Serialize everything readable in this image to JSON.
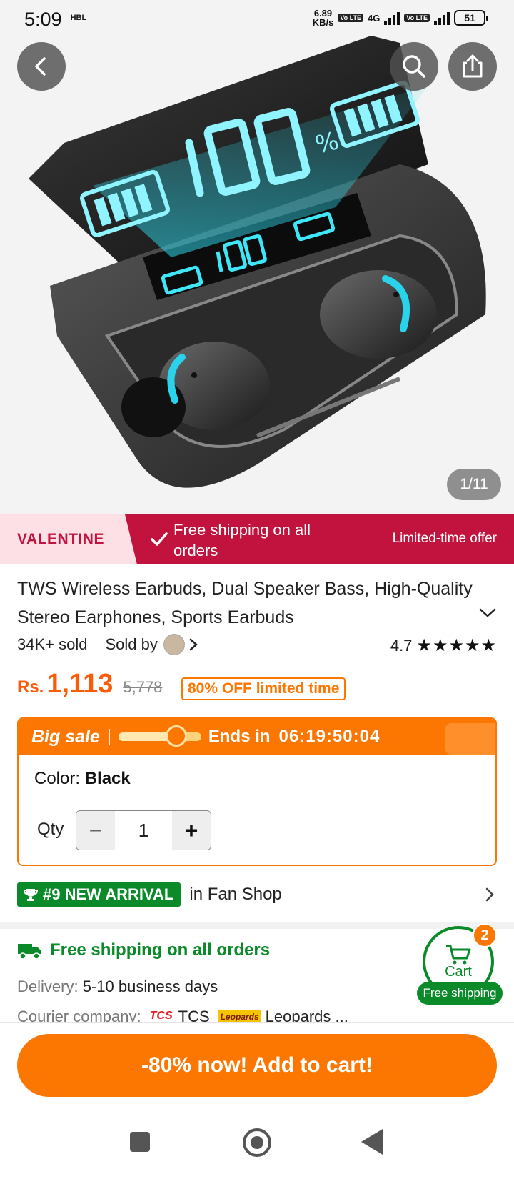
{
  "status_bar": {
    "time": "5:09",
    "carrier": "HBL",
    "speed_value": "6.89",
    "speed_unit": "KB/s",
    "volte": "Vo LTE",
    "network": "4G",
    "battery": "51"
  },
  "gallery": {
    "counter": "1/11"
  },
  "promo": {
    "badge": "VALENTINE",
    "message": "Free shipping on all orders",
    "right_text": "Limited-time offer"
  },
  "product": {
    "title": "TWS Wireless Earbuds, Dual Speaker Bass, High-Quality Stereo Earphones, Sports Earbuds",
    "sold": "34K+ sold",
    "sold_by": "Sold by",
    "rating": "4.7",
    "rating_value": 4.7,
    "stars": "★★★★★"
  },
  "price": {
    "currency": "Rs.",
    "current": "1,113",
    "original": "5,778",
    "discount_label": "80% OFF limited time"
  },
  "sale": {
    "label": "Big sale",
    "ends_label": "Ends in",
    "timer": "06:19:50:04",
    "progress": 0.7,
    "color_label": "Color:",
    "color_value": "Black",
    "qty_label": "Qty",
    "qty_minus": "−",
    "qty_value": "1",
    "qty_plus": "+"
  },
  "arrival": {
    "badge": "#9 NEW ARRIVAL",
    "text": "in Fan Shop"
  },
  "shipping": {
    "title": "Free shipping on all orders",
    "delivery_label": "Delivery:",
    "delivery_value": "5-10 business days",
    "courier_label": "Courier company:",
    "courier_tcs_logo": "TCS",
    "courier_tcs": "TCS",
    "courier_leo_logo": "Leopards",
    "courier_leo": "Leopards ..."
  },
  "cart": {
    "label": "Cart",
    "count": "2",
    "free_shipping": "Free shipping"
  },
  "actions": {
    "add_to_cart": "-80% now! Add to cart!"
  },
  "colors": {
    "accent_orange": "#fb7701",
    "promo_red": "#c2133e",
    "green": "#0a8a28",
    "price_orange": "#fb5b06"
  }
}
